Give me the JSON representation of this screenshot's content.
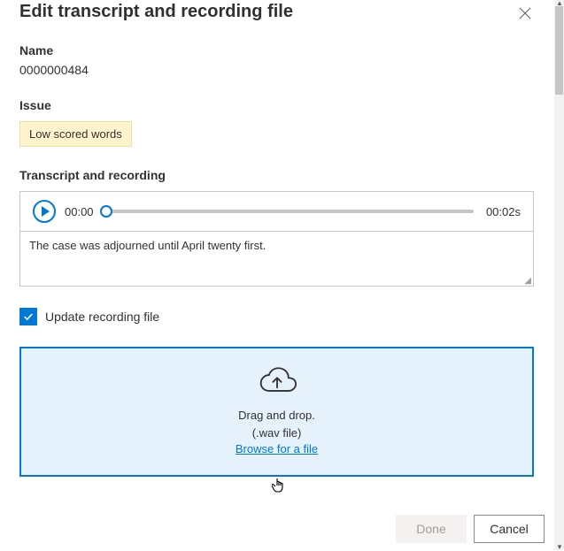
{
  "dialog": {
    "title": "Edit transcript and recording file"
  },
  "name": {
    "label": "Name",
    "value": "0000000484"
  },
  "issue": {
    "label": "Issue",
    "badge": "Low scored words"
  },
  "transcript": {
    "label": "Transcript and recording",
    "current_time": "00:00",
    "duration": "00:02s",
    "text": "The case was adjourned until April twenty first."
  },
  "update_checkbox": {
    "label": "Update recording file",
    "checked": true
  },
  "dropzone": {
    "line1": "Drag and drop.",
    "line2": "(.wav file)",
    "browse": "Browse for a file"
  },
  "footer": {
    "done": "Done",
    "cancel": "Cancel"
  }
}
